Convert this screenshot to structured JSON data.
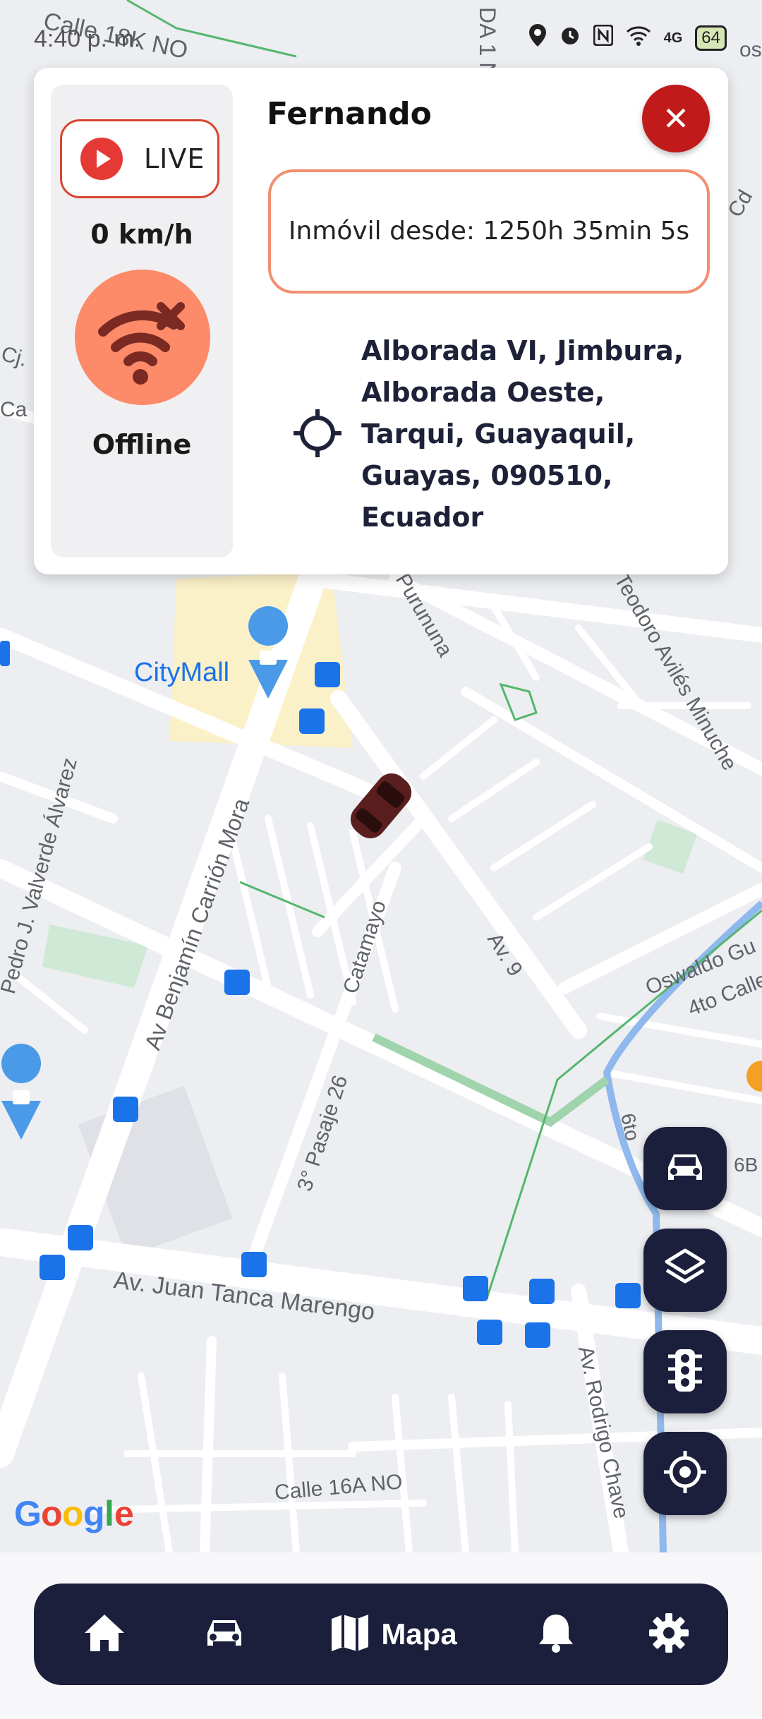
{
  "status_bar": {
    "time": "4:40 p. m.",
    "battery": "64",
    "network": "4G"
  },
  "map": {
    "labels": {
      "calle_18k": "Calle 18K NO",
      "purununa": "Purununa",
      "avilez": "Teodoro Avilés Minuche",
      "citymall": "CityMall",
      "valverde": "Pedro J. Valverde Álvarez",
      "carrion": "Av Benjamín Carrión Mora",
      "catamayo": "Catamayo",
      "av9": "Av. 9",
      "oswaldo": "Oswaldo Gu",
      "cuarto_calle": "4to Calle",
      "pasaje26": "3° Pasaje 26",
      "juan_tanca": "Av. Juan Tanca Marengo",
      "rodrigo": "Av. Rodrigo Chave",
      "calle_16a": "Calle 16A NO",
      "sexto": "6to",
      "sixb": "6B",
      "cj": "Cj.",
      "ca": "Ca",
      "cd": "Cd",
      "dja": "DA 1 N",
      "los": "os"
    },
    "google": [
      "G",
      "o",
      "o",
      "g",
      "l",
      "e"
    ],
    "colors": {
      "road": "#ffffff",
      "block": "#eceef1",
      "park": "#cfe9d6",
      "mall": "#fbf1c9",
      "transit": "#2f7fe0",
      "water": "#8fb8ec"
    }
  },
  "card": {
    "live_label": "LIVE",
    "speed": "0 km/h",
    "connection_status": "Offline",
    "driver_name": "Fernando",
    "idle_text": "Inmóvil desde: 1250h 35min 5s",
    "address": "Alborada VI, Jimbura, Alborada Oeste, Tarqui, Guayaquil, Guayas, 090510, Ecuador",
    "close_icon": "close-icon",
    "offline_icon": "wifi-off-icon",
    "location_icon": "target-icon"
  },
  "fabs": [
    {
      "icon": "car-icon"
    },
    {
      "icon": "layers-icon"
    },
    {
      "icon": "traffic-light-icon"
    },
    {
      "icon": "my-location-icon"
    }
  ],
  "bottom_nav": {
    "items": [
      {
        "icon": "home-icon",
        "label": ""
      },
      {
        "icon": "car-icon",
        "label": ""
      },
      {
        "icon": "map-icon",
        "label": "Mapa"
      },
      {
        "icon": "bell-icon",
        "label": ""
      },
      {
        "icon": "gear-icon",
        "label": ""
      }
    ],
    "active_index": 2
  },
  "colors": {
    "navy": "#1b1f3b",
    "live_red": "#e53935",
    "offline_orange": "#fd8a68",
    "close_red": "#c11a1a",
    "idle_border": "#f18f71"
  }
}
